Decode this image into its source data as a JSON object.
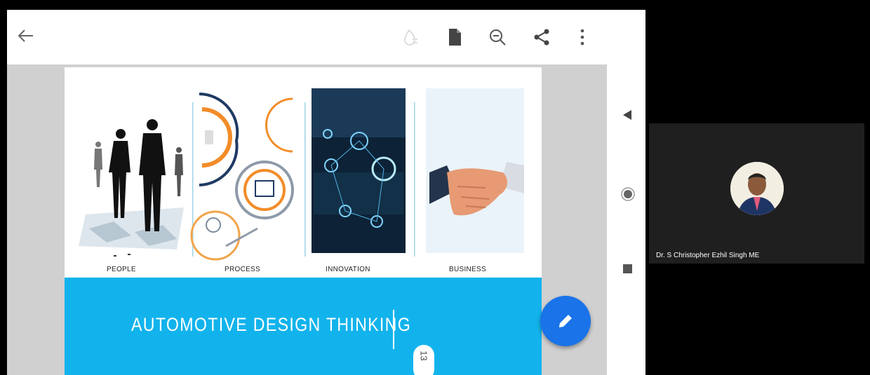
{
  "toolbar": {
    "icons": [
      "back-arrow-icon",
      "ink-drop-icon",
      "document-icon",
      "zoom-out-icon",
      "share-icon",
      "more-vert-icon"
    ]
  },
  "slide": {
    "captions": [
      "PEOPLE",
      "PROCESS",
      "INNOVATION",
      "BUSINESS"
    ],
    "title": "AUTOMOTIVE DESIGN THINKING",
    "page_number": "13"
  },
  "nav": {
    "icons": [
      "nav-back-triangle-icon",
      "nav-home-circle-icon",
      "nav-recents-square-icon"
    ]
  },
  "participant": {
    "name": "Dr. S Christopher Ezhil Singh ME"
  },
  "colors": {
    "band": "#12b3ec",
    "fab": "#1a73e8",
    "viewer_bg": "#d0d0d0"
  }
}
